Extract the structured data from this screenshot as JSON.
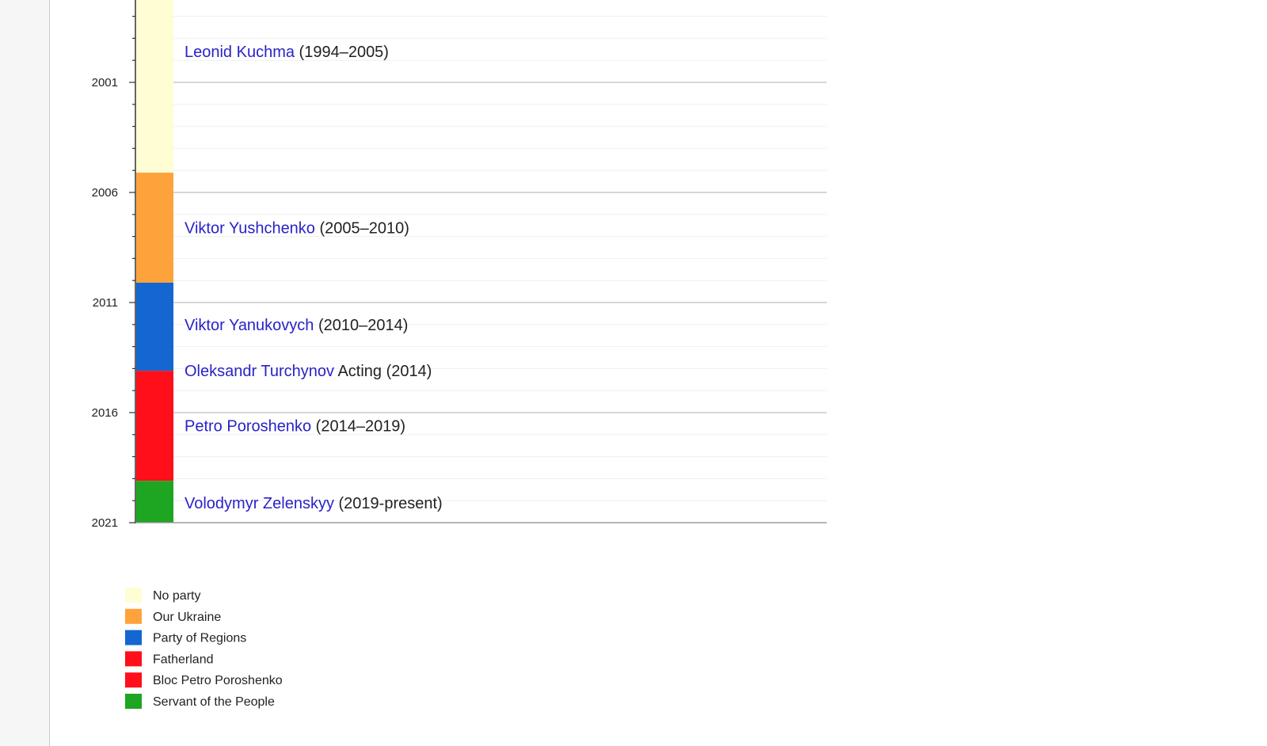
{
  "chart_data": {
    "type": "timeline",
    "y_axis": {
      "range": [
        1997,
        2021
      ],
      "tick_labels": [
        "2001",
        "2006",
        "2011",
        "2016",
        "2021"
      ],
      "major_ticks": [
        2001,
        2006,
        2011,
        2016,
        2021
      ],
      "minor_tick_step": 1
    },
    "grid": true,
    "bars": [
      {
        "party": "No party",
        "start": 1994,
        "end": 2005.1,
        "color": "#fefdd4"
      },
      {
        "party": "Our Ukraine",
        "start": 2005.1,
        "end": 2010.1,
        "color": "#fea33b"
      },
      {
        "party": "Party of Regions",
        "start": 2010.1,
        "end": 2014.1,
        "color": "#1466d0"
      },
      {
        "party": "Fatherland",
        "start": 2014.1,
        "end": 2019.1,
        "color": "#fe0f1a"
      },
      {
        "party": "Servant of the People",
        "start": 2019.1,
        "end": 2021,
        "color": "#1ea521"
      }
    ],
    "labels": [
      {
        "name": "Leonid Kuchma",
        "term": "(1994–2005)",
        "y": 1999.6
      },
      {
        "name": "Viktor Yushchenko",
        "term": "(2005–2010)",
        "y": 2007.6
      },
      {
        "name": "Viktor Yanukovych",
        "term": "(2010–2014)",
        "y": 2012.0
      },
      {
        "name": "Oleksandr Turchynov",
        "term": "Acting (2014)",
        "y": 2014.1
      },
      {
        "name": "Petro Poroshenko",
        "term": "(2014–2019)",
        "y": 2016.6
      },
      {
        "name": "Volodymyr Zelenskyy",
        "term": "(2019-present)",
        "y": 2020.1
      }
    ],
    "legend": [
      {
        "label": "No party",
        "color": "#fefdd4"
      },
      {
        "label": "Our Ukraine",
        "color": "#fea33b"
      },
      {
        "label": "Party of Regions",
        "color": "#1466d0"
      },
      {
        "label": "Fatherland",
        "color": "#fe0f1a"
      },
      {
        "label": "Bloc Petro Poroshenko",
        "color": "#fe0f1a"
      },
      {
        "label": "Servant of the People",
        "color": "#1ea521"
      }
    ],
    "legend_position": "bottom-left"
  }
}
